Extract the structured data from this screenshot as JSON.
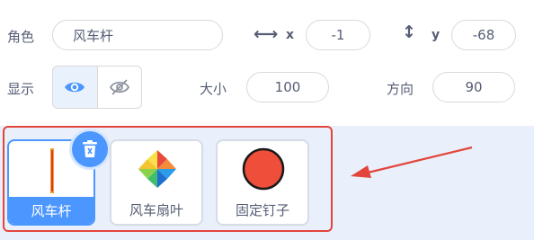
{
  "sprite_panel": {
    "sprite_label": "角色",
    "sprite_name_value": "风车杆",
    "x_label": "x",
    "x_value": "-1",
    "y_label": "y",
    "y_value": "-68",
    "show_label": "显示",
    "size_label": "大小",
    "size_value": "100",
    "direction_label": "方向",
    "direction_value": "90"
  },
  "sprites": [
    {
      "name": "风车杆",
      "selected": true
    },
    {
      "name": "风车扇叶",
      "selected": false
    },
    {
      "name": "固定钉子",
      "selected": false
    }
  ],
  "colors": {
    "accent": "#4c97ff",
    "annotation_red": "#e3453c",
    "sprite_area_bg": "#e9f0fb",
    "text": "#575e75"
  },
  "icons": {
    "move_x": "horizontal-arrows-icon",
    "move_y": "vertical-arrows-icon",
    "show": "eye-icon",
    "hide": "eye-slash-icon",
    "delete": "trash-icon"
  }
}
